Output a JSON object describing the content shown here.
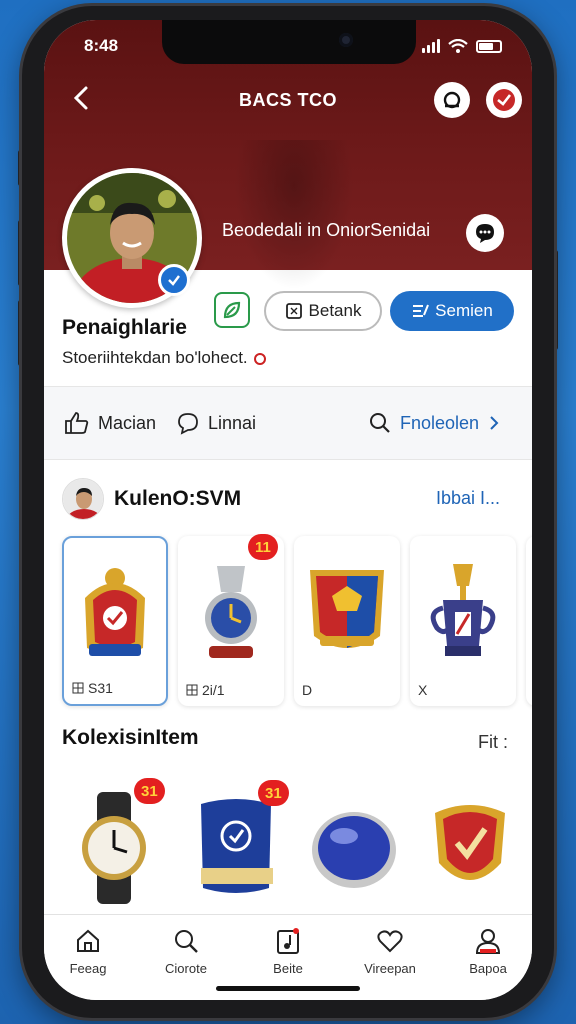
{
  "status_bar": {
    "time": "8:48"
  },
  "header": {
    "title": "BACS TCO",
    "caption": "Beodedali in OniorSenidai"
  },
  "profile": {
    "name": "Penaighlarie",
    "bio": "Stoeriihtekdan bo'lohect.",
    "follow_label": "Betank",
    "primary_label": "Semien"
  },
  "stats": {
    "likes_label": "Macian",
    "comments_label": "Linnai",
    "search_label": "Fnoleolen"
  },
  "collection": {
    "title": "KulenO:SVM",
    "more_label": "Ibbai I...",
    "cards": [
      {
        "meta": "S31",
        "badge": "",
        "icon": "medal-crest-icon"
      },
      {
        "meta": "2i/1",
        "badge": "11",
        "icon": "clock-trophy-icon"
      },
      {
        "meta": "D",
        "badge": "",
        "icon": "shield-crest-icon"
      },
      {
        "meta": "X",
        "badge": "",
        "icon": "cup-trophy-icon"
      }
    ]
  },
  "items": {
    "title": "KolexisinItem",
    "more_label": "Fit :",
    "list": [
      {
        "badge": "31",
        "icon": "wristwatch-icon"
      },
      {
        "badge": "31",
        "icon": "jersey-patch-icon"
      },
      {
        "badge": "",
        "icon": "blue-gem-icon"
      },
      {
        "badge": "",
        "icon": "badge-shield-icon"
      }
    ]
  },
  "tabbar": {
    "tabs": [
      {
        "label": "Feeag",
        "icon": "home-icon"
      },
      {
        "label": "Ciorote",
        "icon": "search-icon"
      },
      {
        "label": "Beite",
        "icon": "music-note-icon"
      },
      {
        "label": "Vireepan",
        "icon": "heart-icon"
      },
      {
        "label": "Bapoa",
        "icon": "profile-icon"
      }
    ]
  },
  "colors": {
    "header": "#6e1a1a",
    "accent": "#2170c8",
    "badge": "#e32020",
    "background": "#1f6fc1"
  }
}
